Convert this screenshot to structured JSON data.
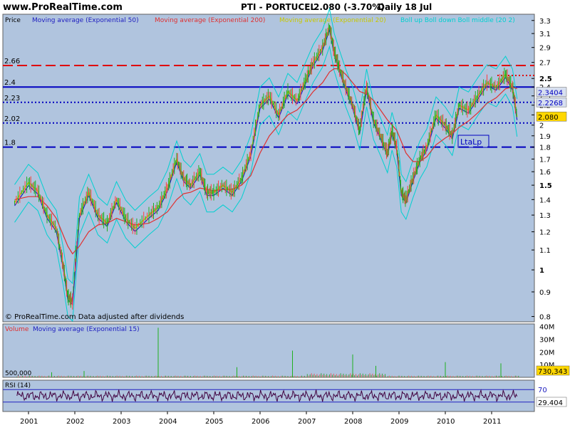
{
  "header": {
    "site": "www.ProRealTime.com",
    "instrument": "PTI - PORTUCEL",
    "last": "2.080 (-3.70%)",
    "period": "Daily  18 Jul"
  },
  "price_panel": {
    "label": "Price",
    "footnote": "© ProRealTime.com  Data adjusted after dividends",
    "legend": [
      {
        "text": "Moving average (Exponential 50)",
        "color": "#2020c0"
      },
      {
        "text": "Moving average (Exponential 200)",
        "color": "#e03030"
      },
      {
        "text": "Moving average (Exponential 20)",
        "color": "#c8c800"
      },
      {
        "text": "Boll up Boll down Boll middle (20 2)",
        "color": "#00d0d0"
      }
    ],
    "annotation": "LtaLp"
  },
  "volume_panel": {
    "legend": [
      {
        "text": "Volume",
        "color": "#e03030"
      },
      {
        "text": "Moving average (Exponential 15)",
        "color": "#2020c0"
      }
    ],
    "left_label": "500,000"
  },
  "rsi_panel": {
    "label": "RSI (14)"
  },
  "colors": {
    "background": "#b0c4de",
    "candles_up": "#ff4040",
    "candles_down": "#20b020",
    "ema20": "#c8c800",
    "ema50": "#2020c0",
    "ema200": "#e03030",
    "bollinger": "#00d0d0"
  },
  "chart_data": [
    {
      "type": "line",
      "title": "PTI - PORTUCEL",
      "scale": "log",
      "ylim": [
        0.78,
        3.4
      ],
      "x_tick_labels": [
        "2001",
        "2002",
        "2003",
        "2004",
        "2005",
        "2006",
        "2007",
        "2008",
        "2009",
        "2010",
        "2011"
      ],
      "y_tick_labels": [
        "0.8",
        "0.9",
        "1",
        "1.1",
        "1.2",
        "1.3",
        "1.4",
        "1.5",
        "1.6",
        "1.7",
        "1.8",
        "1.9",
        "2",
        "2.1",
        "2.2",
        "2.3",
        "2.4",
        "2.5",
        "2.7",
        "2.9",
        "3.1",
        "3.3"
      ],
      "x": [
        2000.7,
        2001.0,
        2001.2,
        2001.4,
        2001.6,
        2001.75,
        2001.85,
        2001.95,
        2002.1,
        2002.3,
        2002.5,
        2002.7,
        2002.9,
        2003.1,
        2003.3,
        2003.6,
        2003.8,
        2004.0,
        2004.2,
        2004.35,
        2004.5,
        2004.7,
        2004.85,
        2005.0,
        2005.2,
        2005.4,
        2005.6,
        2005.8,
        2006.0,
        2006.2,
        2006.4,
        2006.6,
        2006.8,
        2007.0,
        2007.15,
        2007.35,
        2007.5,
        2007.6,
        2007.7,
        2007.85,
        2008.0,
        2008.15,
        2008.3,
        2008.45,
        2008.6,
        2008.75,
        2008.85,
        2008.95,
        2009.05,
        2009.15,
        2009.3,
        2009.45,
        2009.6,
        2009.8,
        2010.0,
        2010.15,
        2010.3,
        2010.5,
        2010.7,
        2010.9,
        2011.1,
        2011.3,
        2011.45,
        2011.55
      ],
      "series": [
        {
          "name": "Price",
          "values": [
            1.38,
            1.52,
            1.46,
            1.3,
            1.22,
            1.02,
            0.88,
            0.86,
            1.3,
            1.45,
            1.3,
            1.25,
            1.4,
            1.28,
            1.22,
            1.3,
            1.35,
            1.48,
            1.7,
            1.55,
            1.5,
            1.6,
            1.45,
            1.45,
            1.5,
            1.45,
            1.55,
            1.75,
            2.2,
            2.3,
            2.1,
            2.35,
            2.25,
            2.5,
            2.7,
            2.9,
            3.2,
            2.85,
            2.65,
            2.4,
            2.2,
            1.95,
            2.4,
            2.05,
            1.9,
            1.75,
            1.95,
            1.8,
            1.45,
            1.4,
            1.55,
            1.7,
            1.8,
            2.1,
            2.0,
            1.9,
            2.2,
            2.15,
            2.3,
            2.45,
            2.4,
            2.55,
            2.4,
            2.08
          ]
        },
        {
          "name": "Moving average (Exponential 200)",
          "values": [
            1.4,
            1.42,
            1.42,
            1.36,
            1.28,
            1.18,
            1.12,
            1.08,
            1.12,
            1.2,
            1.24,
            1.25,
            1.28,
            1.26,
            1.24,
            1.25,
            1.28,
            1.32,
            1.4,
            1.44,
            1.45,
            1.48,
            1.47,
            1.46,
            1.47,
            1.47,
            1.5,
            1.57,
            1.75,
            1.9,
            2.0,
            2.1,
            2.15,
            2.25,
            2.35,
            2.45,
            2.58,
            2.62,
            2.62,
            2.55,
            2.45,
            2.35,
            2.32,
            2.25,
            2.15,
            2.05,
            2.0,
            1.95,
            1.85,
            1.75,
            1.68,
            1.68,
            1.72,
            1.82,
            1.88,
            1.92,
            1.98,
            2.04,
            2.12,
            2.22,
            2.28,
            2.38,
            2.4,
            2.38
          ]
        }
      ],
      "horizontal_lines": [
        {
          "value": 2.66,
          "label": "2.66",
          "style": "dashed",
          "color": "#e00000"
        },
        {
          "value": 2.4,
          "label": "2.4",
          "style": "solid",
          "color": "#0000c0"
        },
        {
          "value": 2.23,
          "label": "2.23",
          "style": "dotted",
          "color": "#0000c0"
        },
        {
          "value": 2.02,
          "label": "2.02",
          "style": "dotted",
          "color": "#0000c0"
        },
        {
          "value": 1.8,
          "label": "1.8",
          "style": "dashed",
          "color": "#0000c0"
        }
      ],
      "right_tags": [
        {
          "value": 2.3404,
          "label": "2.3404",
          "bg": "#d8e0f0",
          "fg": "#0000c0"
        },
        {
          "value": 2.2268,
          "label": "2.2268",
          "bg": "#d8e0f0",
          "fg": "#0000c0"
        },
        {
          "value": 2.08,
          "label": "2.080",
          "bg": "#ffd700",
          "fg": "#000000"
        }
      ]
    },
    {
      "type": "bar",
      "title": "Volume",
      "y_tick_labels": [
        "40M",
        "30M",
        "20M",
        "10M"
      ],
      "ylim": [
        0,
        42000000
      ],
      "right_tag": "730,343",
      "spikes": [
        {
          "x": 2001.5,
          "value": 4000000
        },
        {
          "x": 2002.2,
          "value": 5000000
        },
        {
          "x": 2003.8,
          "value": 39000000
        },
        {
          "x": 2005.5,
          "value": 8000000
        },
        {
          "x": 2006.7,
          "value": 21000000
        },
        {
          "x": 2008.0,
          "value": 18000000
        },
        {
          "x": 2008.5,
          "value": 9000000
        },
        {
          "x": 2010.0,
          "value": 12000000
        },
        {
          "x": 2011.2,
          "value": 11000000
        }
      ]
    },
    {
      "type": "line",
      "title": "RSI (14)",
      "ylim": [
        0,
        100
      ],
      "levels": [
        70,
        30
      ],
      "y_tick_labels": [
        "70"
      ],
      "right_tag": "29.404",
      "last_value": 29.404
    }
  ]
}
